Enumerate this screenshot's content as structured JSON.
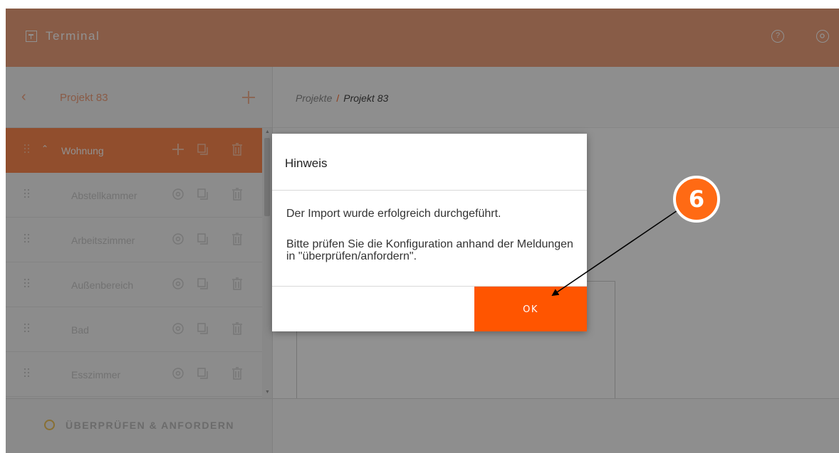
{
  "topbar": {
    "app_name": "Terminal",
    "help_icon": "help-circle-icon",
    "settings_icon": "gear-icon",
    "color": "#f0a27e"
  },
  "sidebar": {
    "project_name": "Projekt 83",
    "group": {
      "label": "Wohnung"
    },
    "rooms": [
      {
        "label": "Abstellkammer"
      },
      {
        "label": "Arbeitszimmer"
      },
      {
        "label": "Außenbereich"
      },
      {
        "label": "Bad"
      },
      {
        "label": "Esszimmer"
      }
    ],
    "footer_label": "ÜBERPRÜFEN & ANFORDERN"
  },
  "breadcrumb": {
    "root": "Projekte",
    "separator": "/",
    "current": "Projekt 83"
  },
  "dialog": {
    "title": "Hinweis",
    "message_1": "Der Import wurde erfolgreich durchgeführt.",
    "message_2": "Bitte prüfen Sie die Konfiguration anhand der Meldungen in \"überprüfen/anfordern\".",
    "ok_label": "OK"
  },
  "annotation": {
    "step_number": "6"
  },
  "colors": {
    "accent": "#ff5500",
    "group_row": "#ff8a4f",
    "badge": "#ff6a14"
  }
}
